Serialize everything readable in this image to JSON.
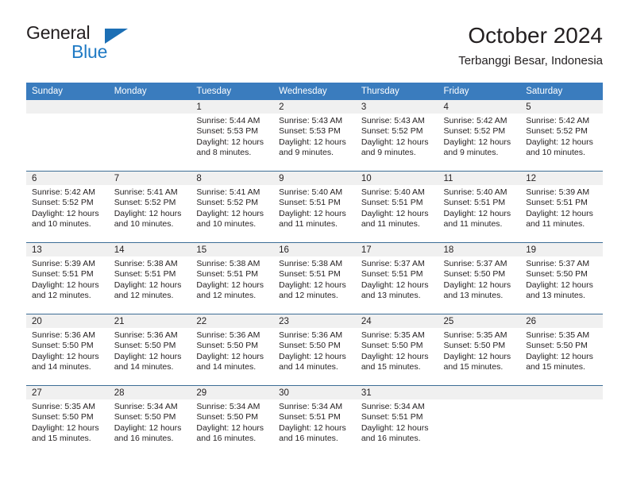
{
  "brand": {
    "word1": "General",
    "word2": "Blue",
    "triangle_color": "#1c6fb5",
    "blue_color": "#1f7ac4"
  },
  "header": {
    "title": "October 2024",
    "subtitle": "Terbanggi Besar, Indonesia",
    "header_bg": "#3a7cbe",
    "daynum_bg": "#f0f0f0"
  },
  "weekday_headers": [
    "Sunday",
    "Monday",
    "Tuesday",
    "Wednesday",
    "Thursday",
    "Friday",
    "Saturday"
  ],
  "labels": {
    "sunrise_prefix": "Sunrise:",
    "sunset_prefix": "Sunset:",
    "daylight_prefix": "Daylight:"
  },
  "weeks": [
    [
      {
        "day": "",
        "sunrise": "",
        "sunset": "",
        "daylight1": "",
        "daylight2": ""
      },
      {
        "day": "",
        "sunrise": "",
        "sunset": "",
        "daylight1": "",
        "daylight2": ""
      },
      {
        "day": "1",
        "sunrise": "Sunrise: 5:44 AM",
        "sunset": "Sunset: 5:53 PM",
        "daylight1": "Daylight: 12 hours",
        "daylight2": "and 8 minutes."
      },
      {
        "day": "2",
        "sunrise": "Sunrise: 5:43 AM",
        "sunset": "Sunset: 5:53 PM",
        "daylight1": "Daylight: 12 hours",
        "daylight2": "and 9 minutes."
      },
      {
        "day": "3",
        "sunrise": "Sunrise: 5:43 AM",
        "sunset": "Sunset: 5:52 PM",
        "daylight1": "Daylight: 12 hours",
        "daylight2": "and 9 minutes."
      },
      {
        "day": "4",
        "sunrise": "Sunrise: 5:42 AM",
        "sunset": "Sunset: 5:52 PM",
        "daylight1": "Daylight: 12 hours",
        "daylight2": "and 9 minutes."
      },
      {
        "day": "5",
        "sunrise": "Sunrise: 5:42 AM",
        "sunset": "Sunset: 5:52 PM",
        "daylight1": "Daylight: 12 hours",
        "daylight2": "and 10 minutes."
      }
    ],
    [
      {
        "day": "6",
        "sunrise": "Sunrise: 5:42 AM",
        "sunset": "Sunset: 5:52 PM",
        "daylight1": "Daylight: 12 hours",
        "daylight2": "and 10 minutes."
      },
      {
        "day": "7",
        "sunrise": "Sunrise: 5:41 AM",
        "sunset": "Sunset: 5:52 PM",
        "daylight1": "Daylight: 12 hours",
        "daylight2": "and 10 minutes."
      },
      {
        "day": "8",
        "sunrise": "Sunrise: 5:41 AM",
        "sunset": "Sunset: 5:52 PM",
        "daylight1": "Daylight: 12 hours",
        "daylight2": "and 10 minutes."
      },
      {
        "day": "9",
        "sunrise": "Sunrise: 5:40 AM",
        "sunset": "Sunset: 5:51 PM",
        "daylight1": "Daylight: 12 hours",
        "daylight2": "and 11 minutes."
      },
      {
        "day": "10",
        "sunrise": "Sunrise: 5:40 AM",
        "sunset": "Sunset: 5:51 PM",
        "daylight1": "Daylight: 12 hours",
        "daylight2": "and 11 minutes."
      },
      {
        "day": "11",
        "sunrise": "Sunrise: 5:40 AM",
        "sunset": "Sunset: 5:51 PM",
        "daylight1": "Daylight: 12 hours",
        "daylight2": "and 11 minutes."
      },
      {
        "day": "12",
        "sunrise": "Sunrise: 5:39 AM",
        "sunset": "Sunset: 5:51 PM",
        "daylight1": "Daylight: 12 hours",
        "daylight2": "and 11 minutes."
      }
    ],
    [
      {
        "day": "13",
        "sunrise": "Sunrise: 5:39 AM",
        "sunset": "Sunset: 5:51 PM",
        "daylight1": "Daylight: 12 hours",
        "daylight2": "and 12 minutes."
      },
      {
        "day": "14",
        "sunrise": "Sunrise: 5:38 AM",
        "sunset": "Sunset: 5:51 PM",
        "daylight1": "Daylight: 12 hours",
        "daylight2": "and 12 minutes."
      },
      {
        "day": "15",
        "sunrise": "Sunrise: 5:38 AM",
        "sunset": "Sunset: 5:51 PM",
        "daylight1": "Daylight: 12 hours",
        "daylight2": "and 12 minutes."
      },
      {
        "day": "16",
        "sunrise": "Sunrise: 5:38 AM",
        "sunset": "Sunset: 5:51 PM",
        "daylight1": "Daylight: 12 hours",
        "daylight2": "and 12 minutes."
      },
      {
        "day": "17",
        "sunrise": "Sunrise: 5:37 AM",
        "sunset": "Sunset: 5:51 PM",
        "daylight1": "Daylight: 12 hours",
        "daylight2": "and 13 minutes."
      },
      {
        "day": "18",
        "sunrise": "Sunrise: 5:37 AM",
        "sunset": "Sunset: 5:50 PM",
        "daylight1": "Daylight: 12 hours",
        "daylight2": "and 13 minutes."
      },
      {
        "day": "19",
        "sunrise": "Sunrise: 5:37 AM",
        "sunset": "Sunset: 5:50 PM",
        "daylight1": "Daylight: 12 hours",
        "daylight2": "and 13 minutes."
      }
    ],
    [
      {
        "day": "20",
        "sunrise": "Sunrise: 5:36 AM",
        "sunset": "Sunset: 5:50 PM",
        "daylight1": "Daylight: 12 hours",
        "daylight2": "and 14 minutes."
      },
      {
        "day": "21",
        "sunrise": "Sunrise: 5:36 AM",
        "sunset": "Sunset: 5:50 PM",
        "daylight1": "Daylight: 12 hours",
        "daylight2": "and 14 minutes."
      },
      {
        "day": "22",
        "sunrise": "Sunrise: 5:36 AM",
        "sunset": "Sunset: 5:50 PM",
        "daylight1": "Daylight: 12 hours",
        "daylight2": "and 14 minutes."
      },
      {
        "day": "23",
        "sunrise": "Sunrise: 5:36 AM",
        "sunset": "Sunset: 5:50 PM",
        "daylight1": "Daylight: 12 hours",
        "daylight2": "and 14 minutes."
      },
      {
        "day": "24",
        "sunrise": "Sunrise: 5:35 AM",
        "sunset": "Sunset: 5:50 PM",
        "daylight1": "Daylight: 12 hours",
        "daylight2": "and 15 minutes."
      },
      {
        "day": "25",
        "sunrise": "Sunrise: 5:35 AM",
        "sunset": "Sunset: 5:50 PM",
        "daylight1": "Daylight: 12 hours",
        "daylight2": "and 15 minutes."
      },
      {
        "day": "26",
        "sunrise": "Sunrise: 5:35 AM",
        "sunset": "Sunset: 5:50 PM",
        "daylight1": "Daylight: 12 hours",
        "daylight2": "and 15 minutes."
      }
    ],
    [
      {
        "day": "27",
        "sunrise": "Sunrise: 5:35 AM",
        "sunset": "Sunset: 5:50 PM",
        "daylight1": "Daylight: 12 hours",
        "daylight2": "and 15 minutes."
      },
      {
        "day": "28",
        "sunrise": "Sunrise: 5:34 AM",
        "sunset": "Sunset: 5:50 PM",
        "daylight1": "Daylight: 12 hours",
        "daylight2": "and 16 minutes."
      },
      {
        "day": "29",
        "sunrise": "Sunrise: 5:34 AM",
        "sunset": "Sunset: 5:50 PM",
        "daylight1": "Daylight: 12 hours",
        "daylight2": "and 16 minutes."
      },
      {
        "day": "30",
        "sunrise": "Sunrise: 5:34 AM",
        "sunset": "Sunset: 5:51 PM",
        "daylight1": "Daylight: 12 hours",
        "daylight2": "and 16 minutes."
      },
      {
        "day": "31",
        "sunrise": "Sunrise: 5:34 AM",
        "sunset": "Sunset: 5:51 PM",
        "daylight1": "Daylight: 12 hours",
        "daylight2": "and 16 minutes."
      },
      {
        "day": "",
        "sunrise": "",
        "sunset": "",
        "daylight1": "",
        "daylight2": ""
      },
      {
        "day": "",
        "sunrise": "",
        "sunset": "",
        "daylight1": "",
        "daylight2": ""
      }
    ]
  ]
}
